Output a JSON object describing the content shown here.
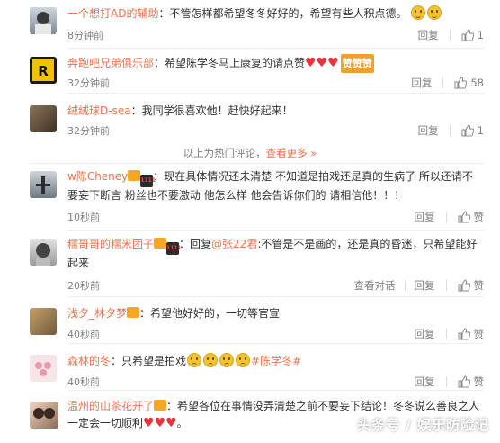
{
  "comments": [
    {
      "user": "一个想打AD的辅助",
      "text": "不管怎样都希望冬冬好好的，希望有些人积点德。",
      "time": "8分钟前",
      "reply": "回复",
      "likes": "1"
    },
    {
      "user": "奔跑吧兄弟俱乐部",
      "text": "希望陈学冬马上康复的请点赞",
      "time": "32分钟前",
      "reply": "回复",
      "likes": "58",
      "badge": "赞赞赞"
    },
    {
      "user": "绒绒球D-sea",
      "text": "我同学很喜欢他！赶快好起来！",
      "time": "32分钟前",
      "reply": "回复",
      "likes": "1"
    },
    {
      "user": "w陈Cheney",
      "text": "现在具体情况还未清楚 不知道是拍戏还是真的生病了 所以还请不要妄下断言 粉丝也不要激动 他怎么样 他会告诉你们的 请相信他！！！",
      "time": "10秒前",
      "reply": "回复",
      "likes": "赞"
    },
    {
      "user": "糯哥哥的糯米团子",
      "mention": "@张22君",
      "text_pre": "回复",
      "text": "不管是不是画的，还是真的昏迷，只希望能好起来",
      "time": "20秒前",
      "view": "查看对话",
      "reply": "回复",
      "likes": "赞"
    },
    {
      "user": "浅夕_林夕梦",
      "text": "希望他好好的，一切等官宣",
      "time": "40秒前",
      "reply": "回复",
      "likes": "赞"
    },
    {
      "user": "森林的冬",
      "text": "只希望是拍戏",
      "hashtag": "#陈学冬#",
      "time": "40秒前",
      "reply": "回复",
      "likes": "赞"
    },
    {
      "user": "温州的山茶花开了",
      "text": "希望各位在事情没弄清楚之前不要妄下结论！冬冬说么善良之人一定会一切顺利",
      "time": "",
      "reply": "",
      "likes": ""
    }
  ],
  "notice": {
    "text": "以上为热门评论，",
    "link": "查看更多 »"
  },
  "watermark": "头条号 / 娱乐防险记"
}
